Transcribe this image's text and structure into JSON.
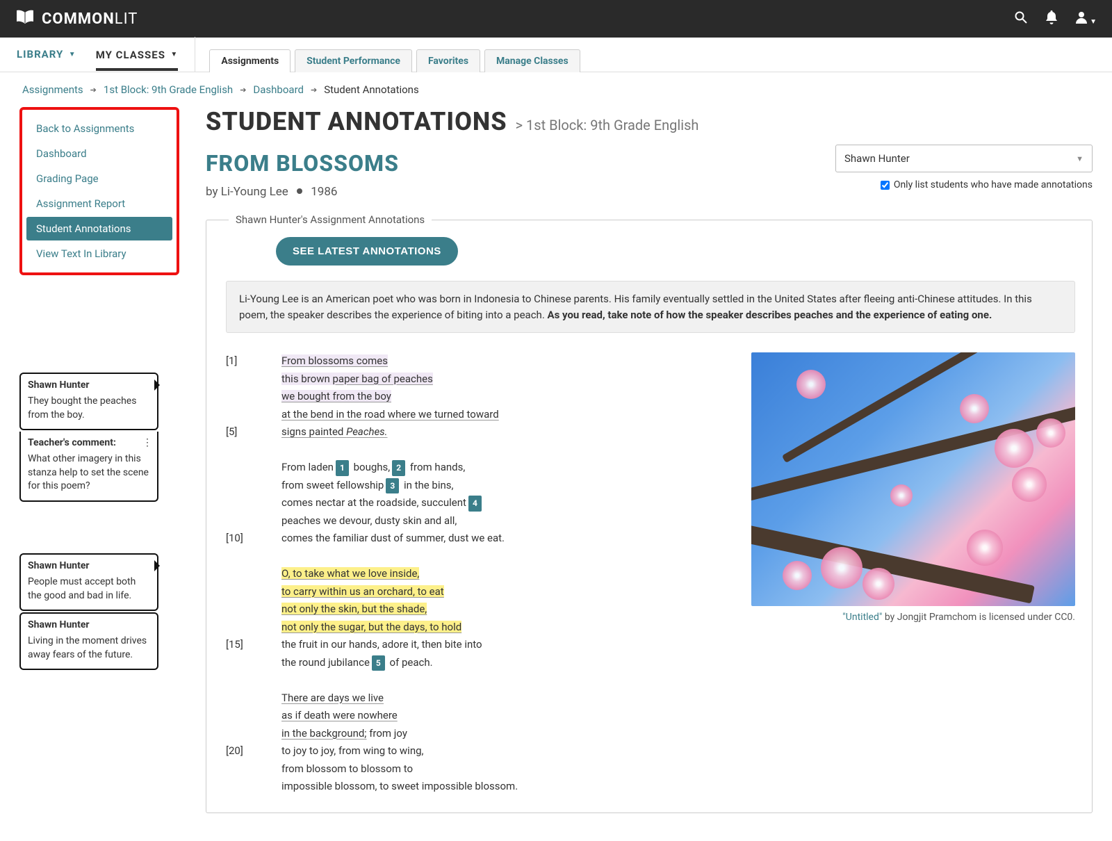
{
  "brand": {
    "bold": "COMMON",
    "light": "LIT"
  },
  "topnav": {
    "library": "LIBRARY",
    "myclasses": "MY CLASSES"
  },
  "tabs": [
    "Assignments",
    "Student Performance",
    "Favorites",
    "Manage Classes"
  ],
  "crumbs": {
    "a": "Assignments",
    "b": "1st Block: 9th Grade English",
    "c": "Dashboard",
    "d": "Student Annotations"
  },
  "side": {
    "items": [
      "Back to Assignments",
      "Dashboard",
      "Grading Page",
      "Assignment Report",
      "Student Annotations",
      "View Text In Library"
    ],
    "active": 4
  },
  "h1": "STUDENT ANNOTATIONS",
  "h1sub": "> 1st Block: 9th Grade English",
  "h2": "FROM BLOSSOMS",
  "author": "by Li-Young Lee",
  "year": "1986",
  "select": {
    "value": "Shawn Hunter"
  },
  "chklabel": "Only list students who have made annotations",
  "legend": "Shawn Hunter's Assignment Annotations",
  "btn": "SEE LATEST ANNOTATIONS",
  "intro_a": "Li-Young Lee is an American poet who was born in Indonesia to Chinese parents. His family eventually settled in the United States after fleeing anti-Chinese attitudes. In this poem, the speaker describes the experience of biting into a peach. ",
  "intro_b": "As you read, take note of how the speaker describes peaches and the experience of eating one.",
  "lnums": {
    "1": "[1]",
    "5": "[5]",
    "10": "[10]",
    "15": "[15]",
    "20": "[20]"
  },
  "poem": {
    "l1": "From blossoms comes",
    "l2a": "this brown ",
    "l2b": "paper bag of peaches",
    "l3": "we bought from the boy",
    "l4": "at the bend in the road where we turned toward",
    "l5a": "signs painted ",
    "l5b": "Peaches.",
    "l6a": "From laden",
    "l6b": " boughs,",
    "l6c": " from hands,",
    "l7a": "from sweet fellowship",
    "l7b": " in the bins,",
    "l8a": "comes nectar at the roadside, succulent",
    "l9": "peaches we devour, dusty skin and all,",
    "l10": "comes the familiar dust of summer, dust we eat.",
    "l11": "O, to take what we love inside,",
    "l12": "to carry within us an orchard, to eat",
    "l13": "not only the skin, but the shade,",
    "l14": "not only the sugar, but the days, to hold",
    "l15": "the fruit in our hands, adore it, then bite into",
    "l16a": "the round jubilance",
    "l16b": " of peach.",
    "l17": "There are days we live",
    "l18": "as if death were nowhere",
    "l19a": "in the background;",
    "l19b": " from joy",
    "l20": "to joy to joy, from wing to wing,",
    "l21": "from blossom to blossom to",
    "l22": "impossible blossom, to sweet impossible blossom."
  },
  "tags": {
    "1": "1",
    "2": "2",
    "3": "3",
    "4": "4",
    "5": "5"
  },
  "caption_a": "\"Untitled\"",
  "caption_b": " by Jongjit Pramchom is licensed under CC0.",
  "notes": {
    "n1h": "Shawn Hunter",
    "n1b": "They bought the peaches from the boy.",
    "tch": "Teacher's comment:",
    "tcb": "What other imagery in this stanza help to set the scene for this poem?",
    "n2h": "Shawn Hunter",
    "n2b": "People must accept both the good and bad in life.",
    "n3h": "Shawn Hunter",
    "n3b": "Living in the moment drives away fears of the future."
  }
}
